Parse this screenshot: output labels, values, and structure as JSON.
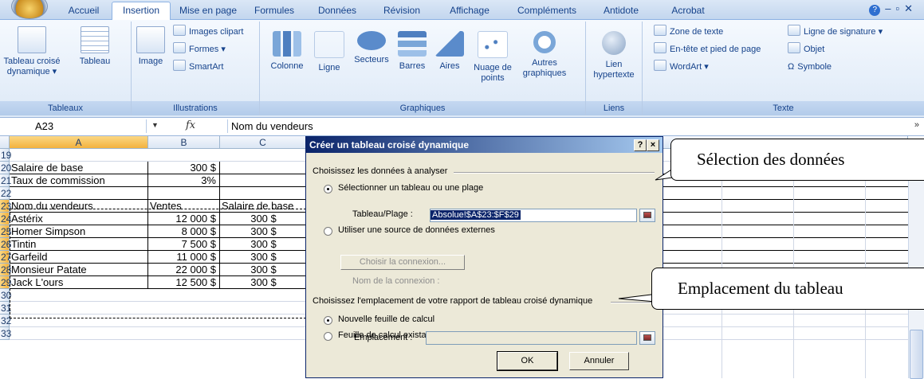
{
  "ribbon": {
    "tabs": [
      "Accueil",
      "Insertion",
      "Mise en page",
      "Formules",
      "Données",
      "Révision",
      "Affichage",
      "Compléments",
      "Antidote",
      "Acrobat"
    ],
    "active_tab": "Insertion",
    "groups": {
      "tableaux": {
        "label": "Tableaux",
        "tcd_label": "Tableau croisé dynamique",
        "tableau_label": "Tableau"
      },
      "illustrations": {
        "label": "Illustrations",
        "image_label": "Image",
        "images_clipart": "Images clipart",
        "formes": "Formes",
        "smartart": "SmartArt"
      },
      "graphiques": {
        "label": "Graphiques",
        "items": [
          "Colonne",
          "Ligne",
          "Secteurs",
          "Barres",
          "Aires",
          "Nuage de points",
          "Autres graphiques"
        ]
      },
      "liens": {
        "label": "Liens",
        "lien_hypertexte": "Lien hypertexte"
      },
      "texte": {
        "label": "Texte",
        "zone_texte": "Zone de texte",
        "entete": "En-tête et pied de page",
        "wordart": "WordArt",
        "ligne_signature": "Ligne de signature",
        "objet": "Objet",
        "symbole": "Symbole"
      }
    }
  },
  "formula_bar": {
    "cell_ref": "A23",
    "fx": "fx",
    "content": "Nom du vendeurs"
  },
  "sheet": {
    "columns": [
      "A",
      "B",
      "C"
    ],
    "rows": [
      {
        "n": "19",
        "a": "",
        "b": "",
        "c": ""
      },
      {
        "n": "20",
        "a": "Salaire de base",
        "b": "300 $",
        "c": ""
      },
      {
        "n": "21",
        "a": "Taux de commission",
        "b": "3%",
        "c": ""
      },
      {
        "n": "22",
        "a": "",
        "b": "",
        "c": ""
      },
      {
        "n": "23",
        "a": "Nom du vendeurs",
        "b": "Ventes",
        "c": "Salaire de base"
      },
      {
        "n": "24",
        "a": "Astérix",
        "b": "12 000  $",
        "c": "300 $"
      },
      {
        "n": "25",
        "a": "Homer Simpson",
        "b": "8 000  $",
        "c": "300 $"
      },
      {
        "n": "26",
        "a": "Tintin",
        "b": "7 500  $",
        "c": "300 $"
      },
      {
        "n": "27",
        "a": "Garfeild",
        "b": "11 000  $",
        "c": "300 $"
      },
      {
        "n": "28",
        "a": "Monsieur Patate",
        "b": "22 000  $",
        "c": "300 $"
      },
      {
        "n": "29",
        "a": "Jack L'ours",
        "b": "12 500  $",
        "c": "300 $"
      },
      {
        "n": "30",
        "a": "",
        "b": "",
        "c": ""
      },
      {
        "n": "31",
        "a": "",
        "b": "",
        "c": ""
      },
      {
        "n": "32",
        "a": "",
        "b": "",
        "c": ""
      },
      {
        "n": "33",
        "a": "",
        "b": "",
        "c": ""
      }
    ]
  },
  "dialog": {
    "title": "Créer un tableau croisé dynamique",
    "help": "?",
    "close": "×",
    "section1": "Choisissez les données à analyser",
    "option_select_range": "Sélectionner un tableau ou une plage",
    "range_label": "Tableau/Plage :",
    "range_value": "Absolue!$A$23:$F$29",
    "option_external": "Utiliser une source de données externes",
    "choose_connection": "Choisir la connexion...",
    "connection_name": "Nom de la connexion :",
    "section2": "Choisissez l'emplacement de votre rapport de tableau croisé dynamique",
    "option_new_sheet": "Nouvelle feuille de calcul",
    "option_existing_sheet": "Feuille de calcul existante",
    "location_label": "Emplacement :",
    "ok": "OK",
    "cancel": "Annuler"
  },
  "callouts": {
    "top": "Sélection des données",
    "bottom": "Emplacement du tableau"
  }
}
